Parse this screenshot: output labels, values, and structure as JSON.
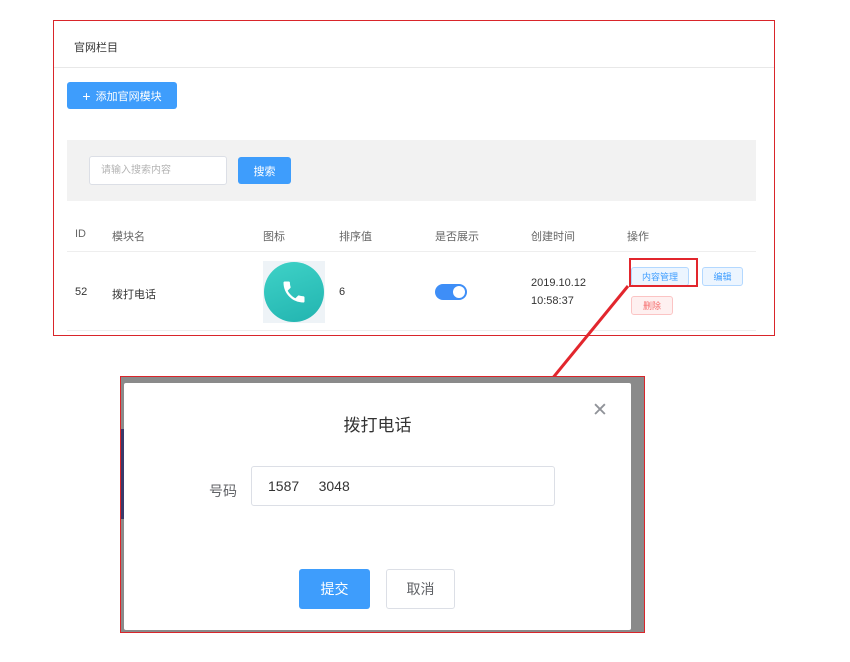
{
  "panel": {
    "title": "官网栏目",
    "add_button_label": "添加官网模块",
    "search": {
      "placeholder": "请输入搜索内容",
      "button_label": "搜索"
    },
    "columns": [
      "ID",
      "模块名",
      "图标",
      "排序值",
      "是否展示",
      "创建时间",
      "操作"
    ],
    "rows": [
      {
        "id": "52",
        "name": "拨打电话",
        "icon": "phone-icon",
        "sort": "6",
        "shown": true,
        "created_date": "2019.10.12",
        "created_time": "10:58:37",
        "actions": {
          "content": "内容管理",
          "edit": "编辑",
          "delete": "删除"
        }
      }
    ]
  },
  "dialog": {
    "title": "拨打电话",
    "phone_label": "号码",
    "phone_value": "1587     3048",
    "submit_label": "提交",
    "cancel_label": "取消",
    "close_icon": "close-icon"
  },
  "colors": {
    "primary": "#3e9dfc",
    "icon_teal": "#2cc3bc",
    "annotation_red": "#e2262d",
    "danger": "#f56c6c"
  }
}
